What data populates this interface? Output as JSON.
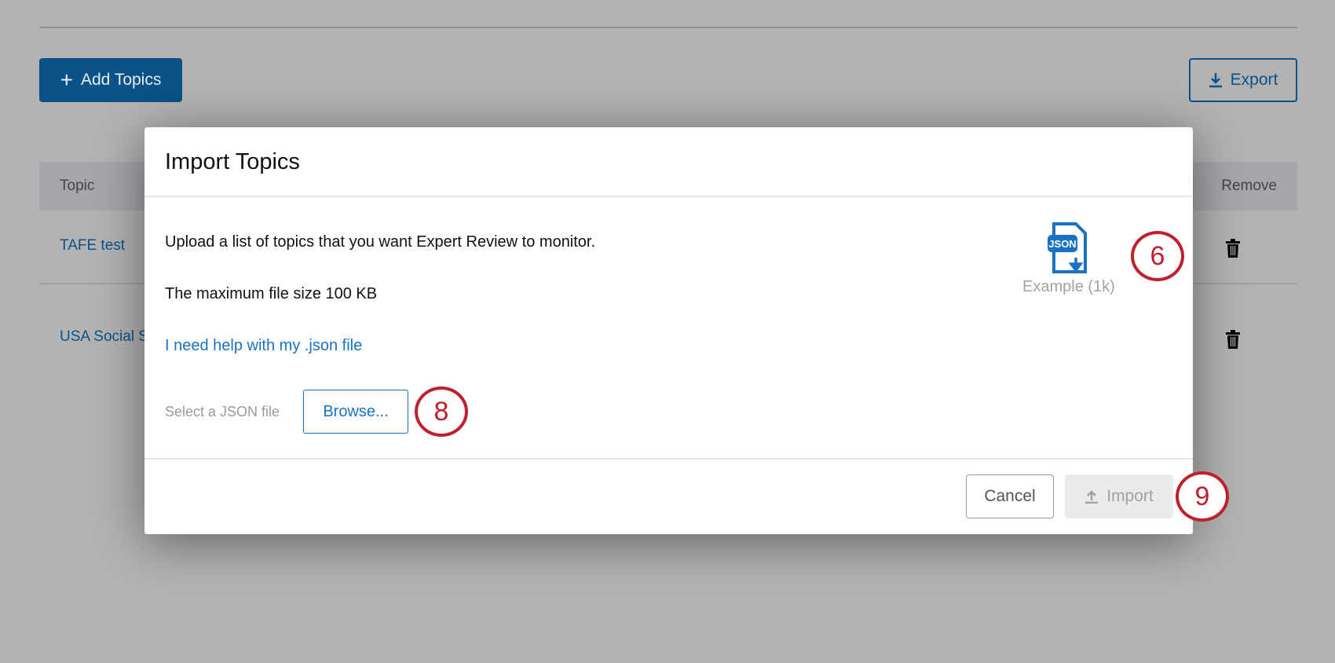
{
  "page": {
    "add_topics_label": "Add Topics",
    "export_label": "Export",
    "table": {
      "headers": [
        "Topic",
        "Remove"
      ],
      "rows": [
        {
          "topic": "TAFE test"
        },
        {
          "topic": "USA Social S"
        }
      ]
    }
  },
  "modal": {
    "title": "Import Topics",
    "description": "Upload a list of topics that you want Expert Review to monitor.",
    "max_size": "The maximum file size 100 KB",
    "help_link": "I need help with my .json file",
    "select_label": "Select a JSON file",
    "browse_label": "Browse...",
    "example_icon_text": "JSON",
    "example_label": "Example (1k)",
    "cancel_label": "Cancel",
    "import_label": "Import"
  },
  "callouts": [
    "6",
    "8",
    "9"
  ],
  "colors": {
    "primary": "#0a5288",
    "link": "#1a73c2",
    "callout": "#c0202e"
  }
}
